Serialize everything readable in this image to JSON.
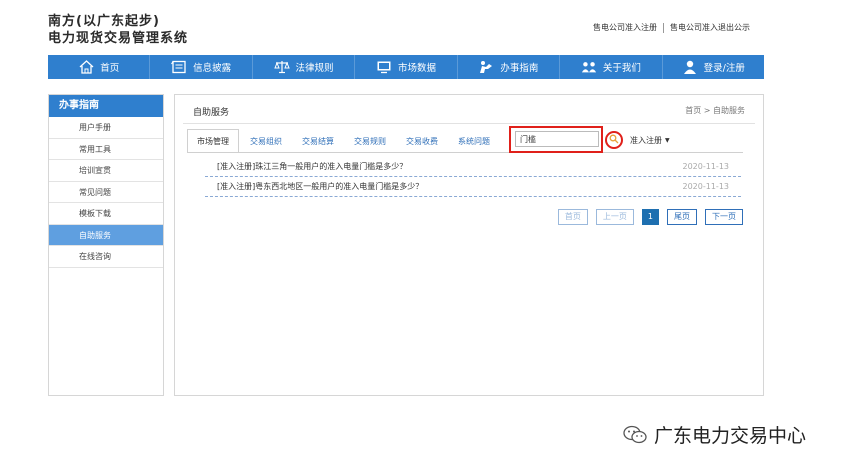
{
  "site": {
    "title_line1": "南方(以广东起步)",
    "title_line2": "电力现货交易管理系统"
  },
  "top_links": {
    "register": "售电公司准入注册",
    "exit_notice": "售电公司准入退出公示"
  },
  "nav": [
    {
      "label": "首页",
      "icon": "home-icon"
    },
    {
      "label": "信息披露",
      "icon": "document-icon"
    },
    {
      "label": "法律规则",
      "icon": "scales-icon"
    },
    {
      "label": "市场数据",
      "icon": "monitor-icon"
    },
    {
      "label": "办事指南",
      "icon": "guide-icon"
    },
    {
      "label": "关于我们",
      "icon": "people-icon"
    },
    {
      "label": "登录/注册",
      "icon": "user-icon"
    }
  ],
  "sidebar": {
    "heading": "办事指南",
    "items": [
      {
        "label": "用户手册"
      },
      {
        "label": "常用工具"
      },
      {
        "label": "培训宣贯"
      },
      {
        "label": "常见问题"
      },
      {
        "label": "模板下载"
      },
      {
        "label": "自助服务"
      },
      {
        "label": "在线咨询"
      }
    ]
  },
  "main": {
    "title": "自助服务",
    "breadcrumb": "首页 > 自助服务",
    "tabs": [
      {
        "label": "市场管理"
      },
      {
        "label": "交易组织"
      },
      {
        "label": "交易结算"
      },
      {
        "label": "交易规则"
      },
      {
        "label": "交易收费"
      },
      {
        "label": "系统问题"
      }
    ],
    "search_value": "门槛",
    "select_value": "准入注册",
    "results": [
      {
        "text": "[准入注册]珠江三角一般用户的准入电量门槛是多少？",
        "date": "2020-11-13"
      },
      {
        "text": "[准入注册]粤东西北地区一般用户的准入电量门槛是多少？",
        "date": "2020-11-13"
      }
    ],
    "pager": {
      "first": "首页",
      "prev": "上一页",
      "current": "1",
      "last": "尾页",
      "next": "下一页"
    }
  },
  "watermark": "广东电力交易中心",
  "colors": {
    "brand_blue": "#2f7fce",
    "highlight_red": "#e0201a"
  }
}
